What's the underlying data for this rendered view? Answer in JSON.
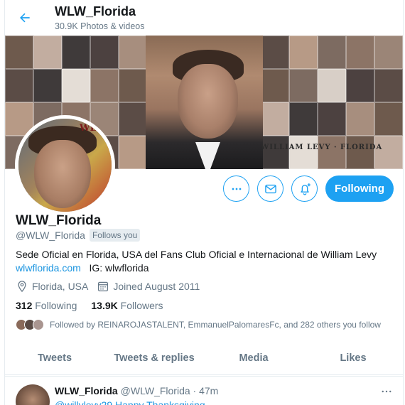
{
  "header": {
    "title": "WLW_Florida",
    "subtitle": "30.9K Photos & videos"
  },
  "profile": {
    "name": "WLW_Florida",
    "handle": "@WLW_Florida",
    "follows_you": "Follows you",
    "bio": "Sede Oficial en Florida, USA del Fans Club Oficial e Internacional de William Levy",
    "website": "wlwflorida.com",
    "ig": "IG: wlwflorida",
    "location": "Florida, USA",
    "joined": "Joined August 2011",
    "following_count": "312",
    "following_label": "Following",
    "followers_count": "13.9K",
    "followers_label": "Followers",
    "followed_by": "Followed by REINAROJASTALENT, EmmanuelPalomaresFc, and 282 others you follow"
  },
  "actions": {
    "following_label": "Following"
  },
  "tabs": [
    "Tweets",
    "Tweets & replies",
    "Media",
    "Likes"
  ],
  "tweet": {
    "name": "WLW_Florida",
    "handle_time": "@WLW_Florida · 47m",
    "text": "@willylevy29 Happy Thanksgiving"
  },
  "banner": {
    "watermark": "WILLIAM LEVY · FLORIDA"
  },
  "avatar": {
    "watermark": "WLW"
  },
  "colors": {
    "accent": "#1da1f2",
    "link": "#1b95e0",
    "muted": "#657786"
  }
}
